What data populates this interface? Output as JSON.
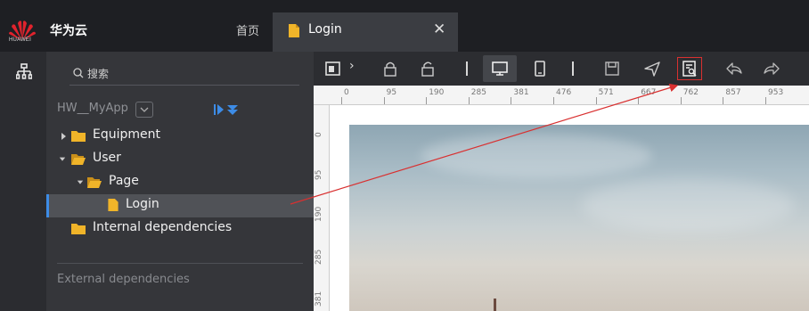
{
  "header": {
    "logo_text": "HUAWEI",
    "brand": "华为云",
    "home": "首页",
    "active_tab": "Login",
    "close_glyph": "✕"
  },
  "sidebar": {
    "search_placeholder": "搜索",
    "project_name": "HW__MyApp",
    "tree": [
      {
        "label": "Equipment",
        "expanded": false,
        "icon": "folder-icon"
      },
      {
        "label": "User",
        "expanded": true,
        "icon": "folder-open-icon"
      },
      {
        "label": "Page",
        "expanded": true,
        "icon": "folder-open-icon"
      },
      {
        "label": "Login",
        "selected": true,
        "icon": "file-icon"
      },
      {
        "label": "Internal dependencies",
        "icon": "folder-icon"
      }
    ],
    "external_label": "External dependencies"
  },
  "toolbar": {
    "chevron": "›",
    "icons": [
      "layout-icon",
      "lock-icon",
      "unlock-icon",
      "desktop-icon",
      "mobile-icon",
      "save-icon",
      "send-icon",
      "preview-icon",
      "undo-icon",
      "redo-icon"
    ]
  },
  "ruler": {
    "top": [
      "0",
      "95",
      "190",
      "285",
      "381",
      "476",
      "571",
      "667",
      "762",
      "857",
      "953"
    ],
    "left": [
      "0",
      "95",
      "190",
      "285",
      "381"
    ]
  },
  "colors": {
    "accent": "#3d8ce6",
    "folder": "#f0b429",
    "highlight": "#d93030"
  }
}
